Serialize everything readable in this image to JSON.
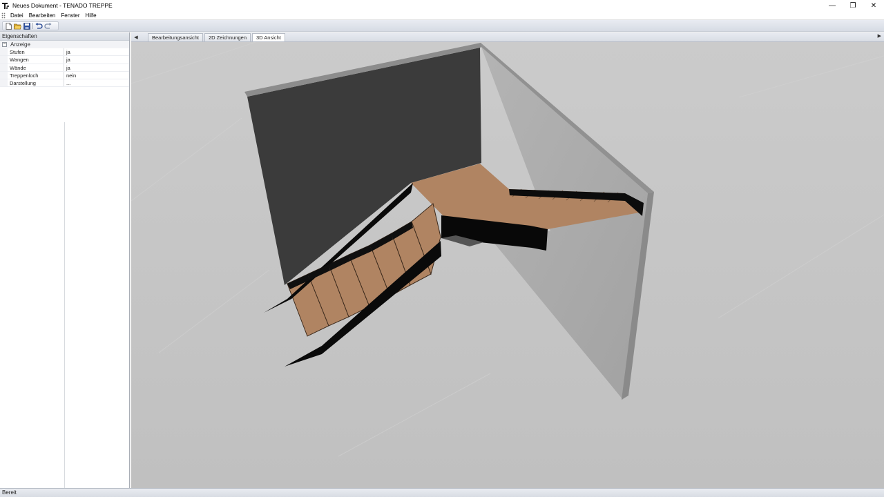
{
  "window": {
    "title": "Neues Dokument - TENADO TREPPE",
    "controls": {
      "minimize": "—",
      "restore": "❐",
      "close": "✕"
    }
  },
  "menu": {
    "items": [
      "Datei",
      "Bearbeiten",
      "Fenster",
      "Hilfe"
    ]
  },
  "toolbar": {
    "icons": [
      "new-document-icon",
      "open-folder-icon",
      "save-icon",
      "undo-icon",
      "redo-icon"
    ]
  },
  "properties_panel": {
    "header": "Eigenschaften",
    "category": {
      "label": "Anzeige",
      "toggle": "−"
    },
    "rows": [
      {
        "name": "Stufen",
        "value": "ja"
      },
      {
        "name": "Wangen",
        "value": "ja"
      },
      {
        "name": "Wände",
        "value": "ja"
      },
      {
        "name": "Treppenloch",
        "value": "nein"
      },
      {
        "name": "Darstellung",
        "value": "..."
      }
    ]
  },
  "document": {
    "tabs": [
      {
        "label": "Bearbeitungsansicht",
        "active": false
      },
      {
        "label": "2D Zeichnungen",
        "active": false
      },
      {
        "label": "3D Ansicht",
        "active": true
      }
    ],
    "nav_left": "◀",
    "nav_right": "▶"
  },
  "status": {
    "text": "Bereit"
  },
  "colors": {
    "viewport_floor": "#c4c4c4",
    "back_wall": "#3a3a3a",
    "side_wall": "#a9a9a9",
    "wall_top": "#8f8f8f",
    "tread_wood": "#b08462",
    "stringer": "#0a0a0a"
  }
}
